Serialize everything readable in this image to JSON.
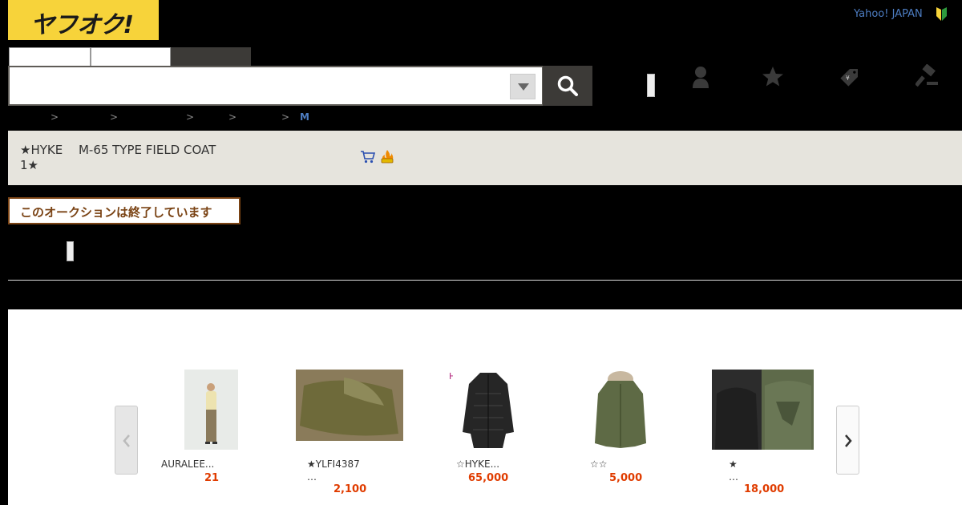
{
  "header": {
    "logo_text": "ヤフオク!",
    "yahoo_link": "Yahoo! JAPAN",
    "search": {
      "query": "",
      "placeholder": ""
    }
  },
  "breadcrumb": {
    "separators": [
      ">",
      ">",
      ">",
      ">",
      ">"
    ],
    "current": "M"
  },
  "item": {
    "title": "★HYKE　 M-65 TYPE FIELD COAT\n1★"
  },
  "notice": {
    "ended": "このオークションは終了しています"
  },
  "recommendations": {
    "items": [
      {
        "name": "AURALEE...",
        "price": "21"
      },
      {
        "name": "★YLFI4387\n…",
        "price": "2,100"
      },
      {
        "name": "☆HYKE...",
        "price": "65,000"
      },
      {
        "name": "☆☆",
        "price": "5,000"
      },
      {
        "name": "★\n…",
        "price": "18,000"
      }
    ],
    "brand_label": "HYKE"
  },
  "colors": {
    "logo_yellow": "#f7d33a",
    "price_orange": "#e03c00",
    "link_blue": "#4d7dc2",
    "notice_brown": "#7a4314",
    "title_band": "#e6e4dd"
  },
  "icons": [
    "search-icon",
    "chevron-down-icon",
    "user-icon",
    "star-icon",
    "tag-icon",
    "gavel-icon",
    "beginner-mark-icon",
    "cart-icon",
    "fire-icon",
    "chevron-left-icon",
    "chevron-right-icon"
  ]
}
